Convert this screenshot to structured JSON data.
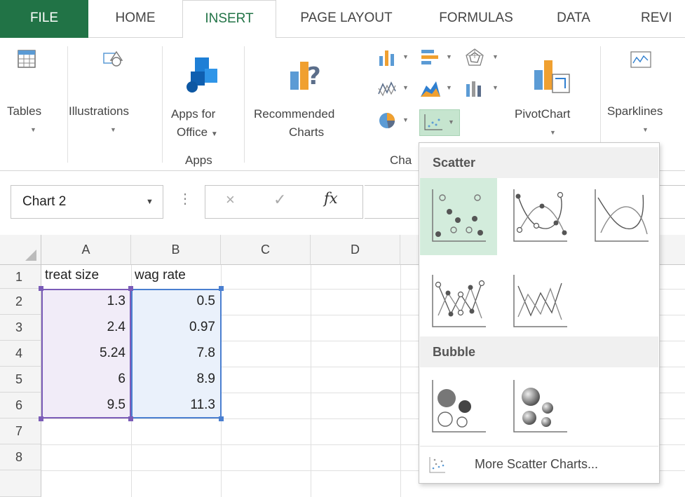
{
  "tabs": {
    "file": "FILE",
    "home": "HOME",
    "insert": "INSERT",
    "page_layout": "PAGE LAYOUT",
    "formulas": "FORMULAS",
    "data": "DATA",
    "review": "REVI"
  },
  "ribbon": {
    "tables": "Tables",
    "illustrations": "Illustrations",
    "apps_for_office_1": "Apps for",
    "apps_for_office_2": "Office",
    "apps_group": "Apps",
    "recommended_1": "Recommended",
    "recommended_2": "Charts",
    "charts_group": "Cha",
    "pivotchart": "PivotChart",
    "sparklines": "Sparklines"
  },
  "formula_bar": {
    "name_box": "Chart 2",
    "fx": "fx",
    "cancel": "×",
    "enter": "✓"
  },
  "grid": {
    "columns": [
      "A",
      "B",
      "C",
      "D"
    ],
    "rows": [
      "1",
      "2",
      "3",
      "4",
      "5",
      "6",
      "7",
      "8"
    ],
    "headers": [
      "treat size",
      "wag rate"
    ],
    "data": [
      [
        "1.3",
        "0.5"
      ],
      [
        "2.4",
        "0.97"
      ],
      [
        "5.24",
        "7.8"
      ],
      [
        "6",
        "8.9"
      ],
      [
        "9.5",
        "11.3"
      ]
    ]
  },
  "dropdown": {
    "scatter_title": "Scatter",
    "bubble_title": "Bubble",
    "more": "More Scatter Charts...",
    "scatter_items": [
      "scatter",
      "scatter-smooth-markers",
      "scatter-smooth-lines",
      "scatter-straight-markers",
      "scatter-straight-lines"
    ],
    "bubble_items": [
      "bubble",
      "bubble-3d"
    ]
  },
  "colors": {
    "excel_green": "#217346",
    "selected_item": "#d3ecdc",
    "range_a": "#7b5cb8",
    "range_b": "#4a7fd0"
  }
}
